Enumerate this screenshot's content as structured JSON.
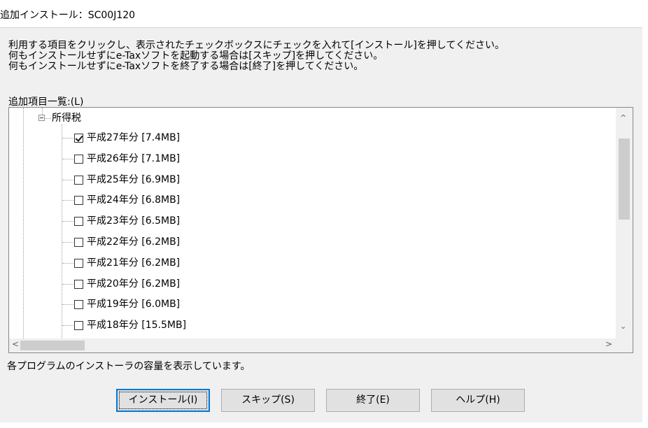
{
  "window": {
    "title": "追加インストール：SC00J120"
  },
  "instructions": [
    "利用する項目をクリックし、表示されたチェックボックスにチェックを入れて[インストール]を押してください。",
    "何もインストールせずにe-Taxソフトを起動する場合は[スキップ]を押してください。",
    "何もインストールせずにe-Taxソフトを終了する場合は[終了]を押してください。"
  ],
  "list_label": "追加項目一覧:(L)",
  "tree": {
    "parent": {
      "label": "所得税",
      "expanded": true
    },
    "items": [
      {
        "label": "平成27年分 [7.4MB]",
        "checked": true
      },
      {
        "label": "平成26年分 [7.1MB]",
        "checked": false
      },
      {
        "label": "平成25年分 [6.9MB]",
        "checked": false
      },
      {
        "label": "平成24年分 [6.8MB]",
        "checked": false
      },
      {
        "label": "平成23年分 [6.5MB]",
        "checked": false
      },
      {
        "label": "平成22年分 [6.2MB]",
        "checked": false
      },
      {
        "label": "平成21年分 [6.2MB]",
        "checked": false
      },
      {
        "label": "平成20年分 [6.2MB]",
        "checked": false
      },
      {
        "label": "平成19年分 [6.0MB]",
        "checked": false
      },
      {
        "label": "平成18年分 [15.5MB]",
        "checked": false
      }
    ]
  },
  "icons": {
    "scroll_up": "^",
    "scroll_down": "⌄",
    "scroll_left": "<",
    "scroll_right": ">"
  },
  "status_text": "各プログラムのインストーラの容量を表示しています。",
  "buttons": {
    "install": "インストール(I)",
    "skip": "スキップ(S)",
    "exit": "終了(E)",
    "help": "ヘルプ(H)"
  }
}
